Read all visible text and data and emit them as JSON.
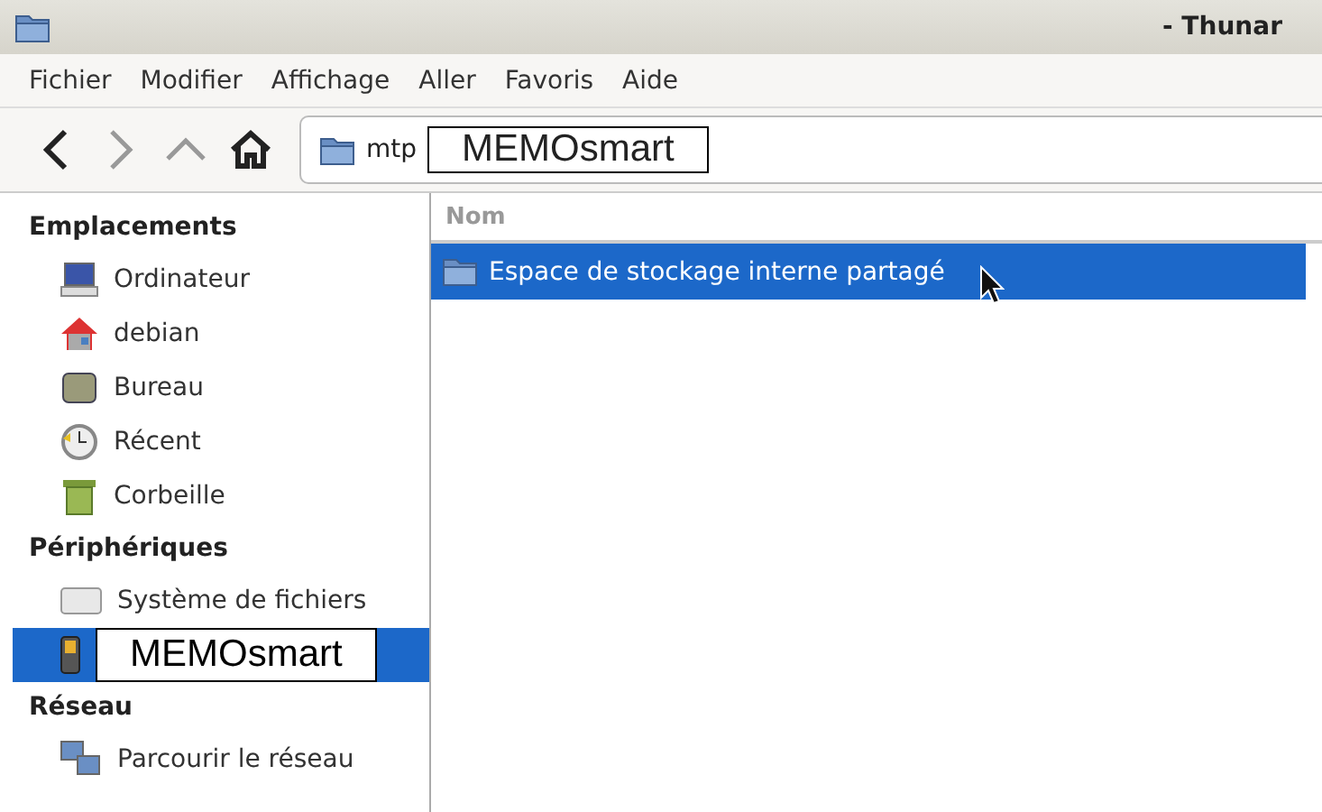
{
  "window": {
    "title": "- Thunar"
  },
  "menu": [
    "Fichier",
    "Modifier",
    "Affichage",
    "Aller",
    "Favoris",
    "Aide"
  ],
  "location": {
    "segments": [
      "mtp",
      "MEMOsmart"
    ]
  },
  "sidebar": [
    {
      "heading": "Emplacements",
      "items": [
        {
          "label": "Ordinateur",
          "selected": false
        },
        {
          "label": "debian",
          "selected": false
        },
        {
          "label": "Bureau",
          "selected": false
        },
        {
          "label": "Récent",
          "selected": false
        },
        {
          "label": "Corbeille",
          "selected": false
        }
      ]
    },
    {
      "heading": "Périphériques",
      "items": [
        {
          "label": "Système de fichiers",
          "selected": false
        },
        {
          "label": "MEMOsmart",
          "selected": true
        }
      ]
    },
    {
      "heading": "Réseau",
      "items": [
        {
          "label": "Parcourir le réseau",
          "selected": false
        }
      ]
    }
  ],
  "table": {
    "columns": [
      "Nom"
    ],
    "rows": [
      {
        "name": "Espace de stockage interne partagé",
        "selected": true
      }
    ]
  }
}
